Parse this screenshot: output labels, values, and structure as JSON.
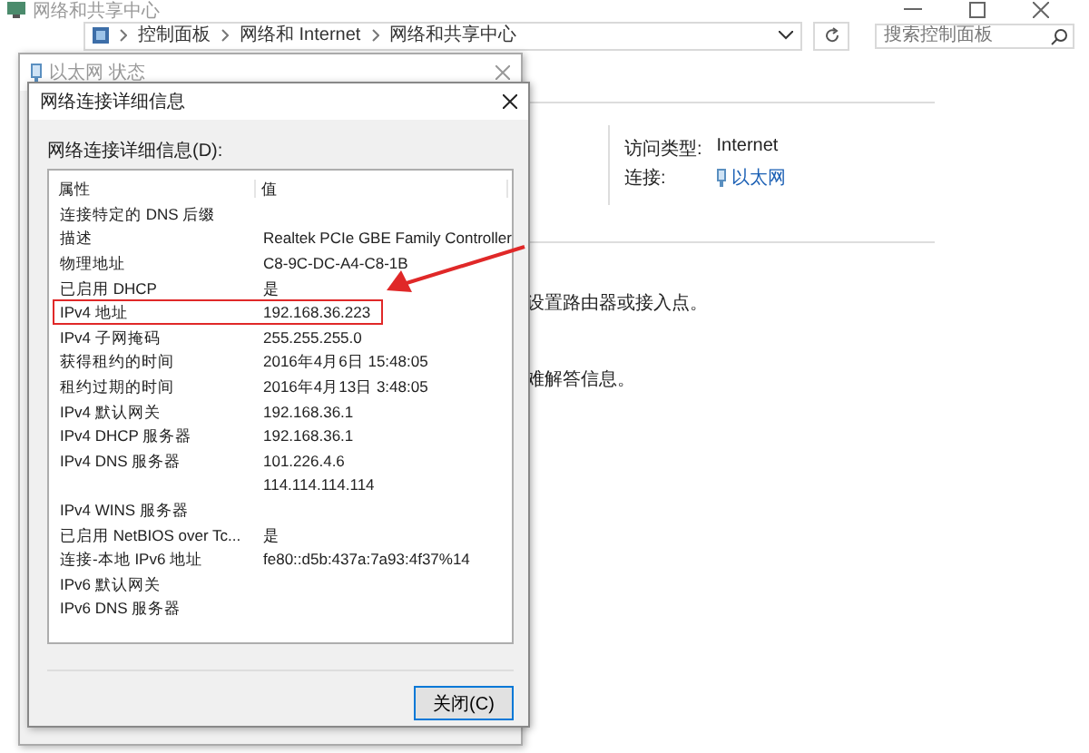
{
  "window": {
    "title": "网络和共享中心",
    "breadcrumbs": [
      "控制面板",
      "网络和 Internet",
      "网络和共享中心"
    ],
    "search": {
      "placeholder": "搜索控制面板"
    }
  },
  "network_info": {
    "access_type_label": "访问类型:",
    "access_type": "Internet",
    "connection_label": "连接:",
    "connection": "以太网"
  },
  "tasks": [
    "设置路由器或接入点。",
    "难解答信息。"
  ],
  "status_dialog": {
    "title": "以太网 状态"
  },
  "details_dialog": {
    "title": "网络连接详细信息",
    "list_label": "网络连接详细信息(D):",
    "columns": [
      "属性",
      "值"
    ],
    "rows": [
      {
        "property": "连接特定的 DNS 后缀",
        "highlighted": false
      },
      {
        "property": "描述",
        "value": "Realtek PCIe GBE Family Controller",
        "highlighted": false
      },
      {
        "property": "物理地址",
        "value": "C8-9C-DC-A4-C8-1B",
        "highlighted": false
      },
      {
        "property": "已启用 DHCP",
        "value": "是",
        "highlighted": false
      },
      {
        "property": "IPv4 地址",
        "value": "192.168.36.223",
        "highlighted": true
      },
      {
        "property": "IPv4 子网掩码",
        "value": "255.255.255.0",
        "highlighted": false
      },
      {
        "property": "获得租约的时间",
        "value": "2016年4月6日 15:48:05",
        "highlighted": false
      },
      {
        "property": "租约过期的时间",
        "value": "2016年4月13日 3:48:05",
        "highlighted": false
      },
      {
        "property": "IPv4 默认网关",
        "value": "192.168.36.1",
        "highlighted": false
      },
      {
        "property": "IPv4 DHCP 服务器",
        "value": "192.168.36.1",
        "highlighted": false
      },
      {
        "property": "IPv4 DNS 服务器",
        "value": "101.226.4.6",
        "highlighted": false
      },
      {
        "value": "114.114.114.114",
        "highlighted": false
      },
      {
        "property": "IPv4 WINS 服务器",
        "highlighted": false
      },
      {
        "property": "已启用 NetBIOS over Tc...",
        "value": "是",
        "highlighted": false
      },
      {
        "property": "连接-本地 IPv6 地址",
        "value": "fe80::d5b:437a:7a93:4f37%14",
        "highlighted": false
      },
      {
        "property": "IPv6 默认网关",
        "highlighted": false
      },
      {
        "property": "IPv6 DNS 服务器",
        "highlighted": false
      }
    ],
    "close_button": "关闭(C)"
  }
}
